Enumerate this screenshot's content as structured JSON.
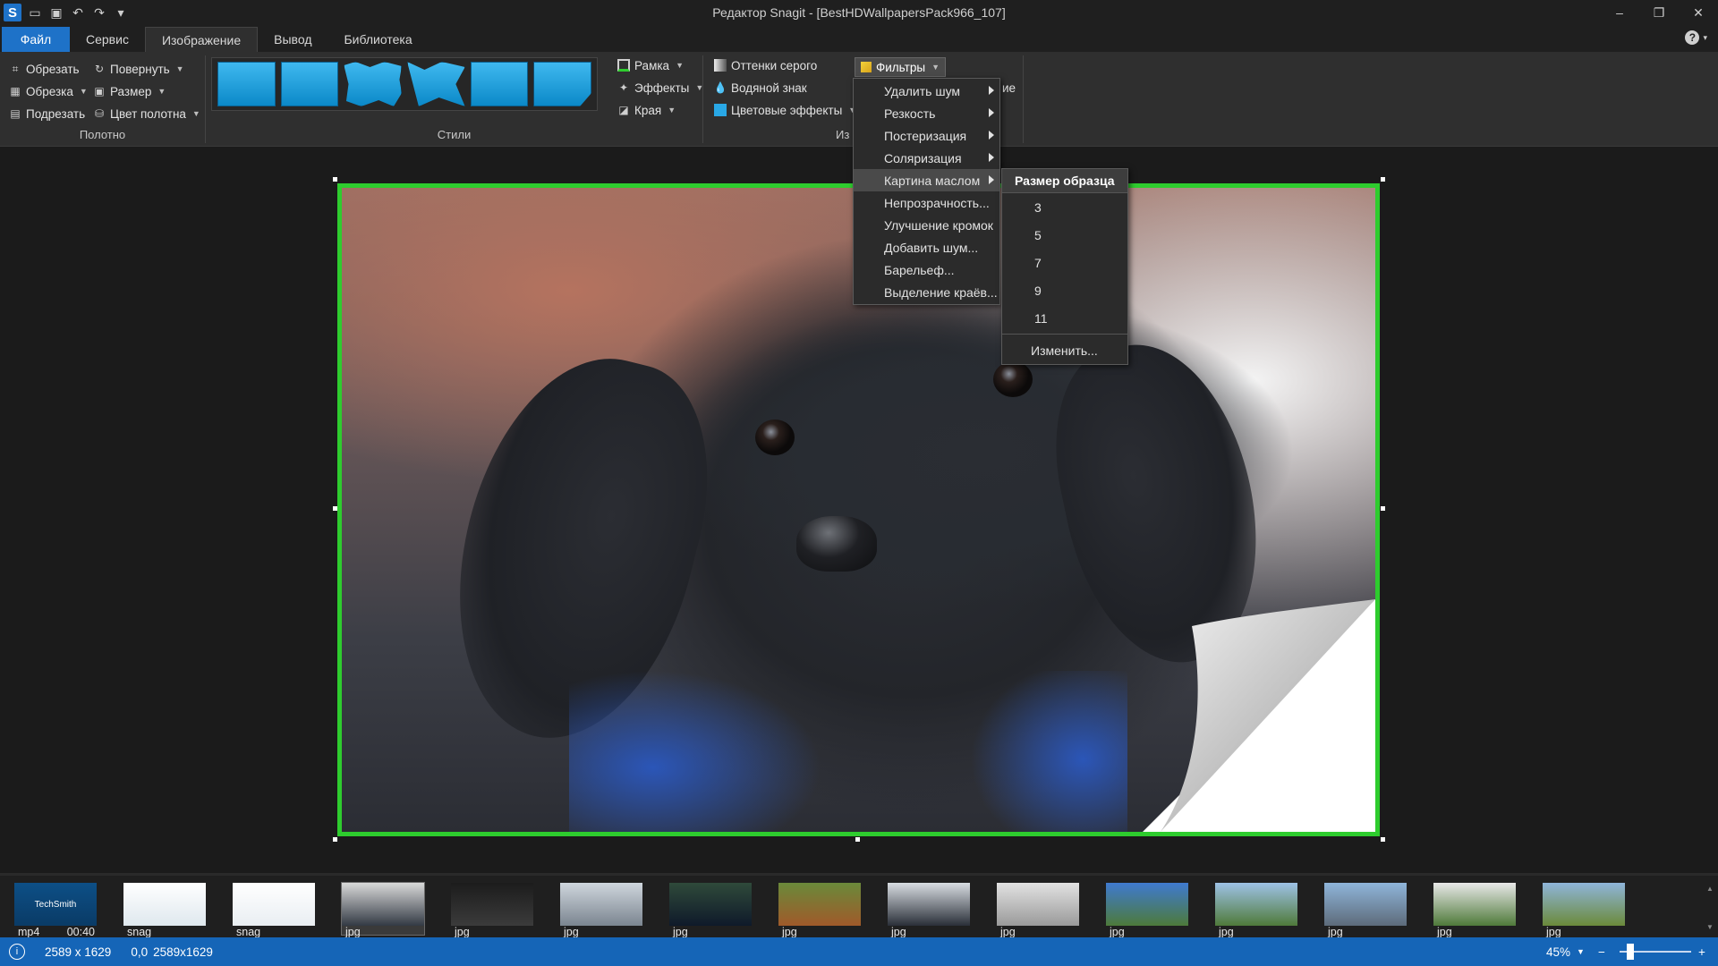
{
  "window": {
    "title": "Редактор Snagit - [BestHDWallpapersPack966_107]"
  },
  "tabs": [
    "Файл",
    "Сервис",
    "Изображение",
    "Вывод",
    "Библиотека"
  ],
  "ribbon": {
    "canvas_group": {
      "label": "Полотно",
      "crop": "Обрезать",
      "rotate": "Повернуть",
      "trim": "Обрезка",
      "resize": "Размер",
      "cut_out": "Подрезать",
      "canvas_color": "Цвет полотна"
    },
    "styles_group": {
      "label": "Стили"
    },
    "effects_group": {
      "frame": "Рамка",
      "effects": "Эффекты",
      "edges": "Края",
      "grayscale": "Оттенки серого",
      "watermark": "Водяной знак",
      "color_effects": "Цветовые эффекты",
      "filters": "Фильтры",
      "label_fragment": "Из",
      "hidden_fragment": "ие"
    }
  },
  "filters_menu": {
    "items": [
      {
        "label": "Удалить шум",
        "submenu": true
      },
      {
        "label": "Резкость",
        "submenu": true
      },
      {
        "label": "Постеризация",
        "submenu": true
      },
      {
        "label": "Соляризация",
        "submenu": true
      },
      {
        "label": "Картина маслом",
        "submenu": true,
        "highlighted": true
      },
      {
        "label": "Непрозрачность...",
        "submenu": false
      },
      {
        "label": "Улучшение кромок",
        "submenu": false
      },
      {
        "label": "Добавить шум...",
        "submenu": false
      },
      {
        "label": "Барельеф...",
        "submenu": false
      },
      {
        "label": "Выделение краёв...",
        "submenu": false
      }
    ]
  },
  "oil_painting_submenu": {
    "header": "Размер образца",
    "options": [
      "3",
      "5",
      "7",
      "9",
      "11"
    ],
    "custom": "Изменить..."
  },
  "tray": [
    {
      "type": "mp4",
      "extra": "00:40",
      "colors": [
        "#0d4f86",
        "#0a3b66"
      ],
      "brand": "TechSmith"
    },
    {
      "type": "snag",
      "extra": "",
      "colors": [
        "#ffffff",
        "#dfe8ee"
      ]
    },
    {
      "type": "snag",
      "extra": "",
      "colors": [
        "#ffffff",
        "#e9eef2"
      ]
    },
    {
      "type": "jpg",
      "extra": "",
      "colors": [
        "#d9d9d9",
        "#333a44"
      ],
      "selected": true
    },
    {
      "type": "jpg",
      "extra": "",
      "colors": [
        "#1c1c1c",
        "#3b3b3b"
      ]
    },
    {
      "type": "jpg",
      "extra": "",
      "colors": [
        "#cfd6dd",
        "#7b8590"
      ]
    },
    {
      "type": "jpg",
      "extra": "",
      "colors": [
        "#2f4a3a",
        "#0f1a2a"
      ]
    },
    {
      "type": "jpg",
      "extra": "",
      "colors": [
        "#6a8a3a",
        "#a05a2a"
      ]
    },
    {
      "type": "jpg",
      "extra": "",
      "colors": [
        "#d8dde2",
        "#2a2f38"
      ]
    },
    {
      "type": "jpg",
      "extra": "",
      "colors": [
        "#e2e2e2",
        "#9a9a9a"
      ]
    },
    {
      "type": "jpg",
      "extra": "",
      "colors": [
        "#3f7ad0",
        "#4d7a3a"
      ]
    },
    {
      "type": "jpg",
      "extra": "",
      "colors": [
        "#9ec2e6",
        "#4f7a3a"
      ]
    },
    {
      "type": "jpg",
      "extra": "",
      "colors": [
        "#8fb5da",
        "#5d6b7a"
      ]
    },
    {
      "type": "jpg",
      "extra": "",
      "colors": [
        "#e8e8e8",
        "#4f7a3a"
      ]
    },
    {
      "type": "jpg",
      "extra": "",
      "colors": [
        "#8fb5da",
        "#6b8a3a"
      ]
    }
  ],
  "status": {
    "dimensions": "2589 x 1629",
    "cursor": "0,0",
    "selection": "2589x1629",
    "zoom": "45%",
    "zoom_minus": "−",
    "zoom_plus": "+"
  },
  "colors": {
    "accent": "#1e72c8",
    "status_bar": "#1565b7",
    "image_border": "#2ecc2e"
  }
}
